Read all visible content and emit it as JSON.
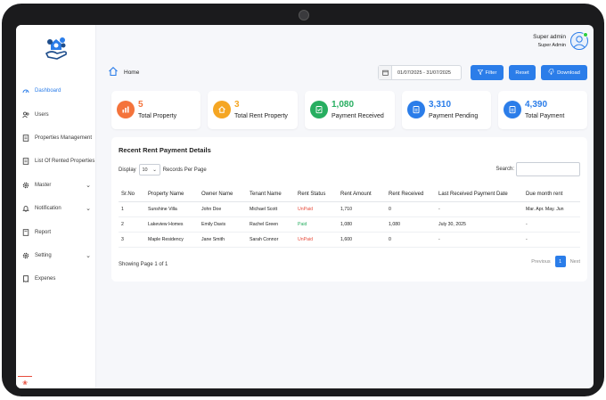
{
  "user": {
    "name": "Super admin",
    "role": "Super Admin"
  },
  "breadcrumb": {
    "label": "Home"
  },
  "filters": {
    "date_range": "01/07/2025 - 31/07/2025",
    "filter_label": "Filter",
    "reset_label": "Reset",
    "download_label": "Download"
  },
  "sidebar": {
    "items": [
      {
        "label": "Dashboard",
        "icon": "dashboard-icon",
        "active": true
      },
      {
        "label": "Users",
        "icon": "users-icon"
      },
      {
        "label": "Properties Management",
        "icon": "document-icon"
      },
      {
        "label": "List Of Rented Properties",
        "icon": "document-icon"
      },
      {
        "label": "Master",
        "icon": "gear-icon",
        "expandable": true
      },
      {
        "label": "Notification",
        "icon": "bell-icon",
        "expandable": true
      },
      {
        "label": "Report",
        "icon": "report-icon"
      },
      {
        "label": "Setting",
        "icon": "gear-icon",
        "expandable": true
      },
      {
        "label": "Expenes",
        "icon": "receipt-icon"
      }
    ]
  },
  "cards": [
    {
      "value": "5",
      "label": "Total Property",
      "color": "#f4733b"
    },
    {
      "value": "3",
      "label": "Total Rent Property",
      "color": "#f5a623"
    },
    {
      "value": "1,080",
      "label": "Payment Received",
      "color": "#27ae60"
    },
    {
      "value": "3,310",
      "label": "Payment Pending",
      "color": "#2b7de9"
    },
    {
      "value": "4,390",
      "label": "Total Payment",
      "color": "#2b7de9"
    }
  ],
  "table_section": {
    "title": "Recent Rent Payment Details",
    "display_label": "Display",
    "per_page_value": "10",
    "records_label": "Records Per Page",
    "search_label": "Search:",
    "showing_text": "Showing Page 1 of 1",
    "pager": {
      "previous": "Previous",
      "page": "1",
      "next": "Next"
    },
    "columns": [
      "Sr.No",
      "Property Name",
      "Owner Name",
      "Tenant Name",
      "Rent Status",
      "Rent Amount",
      "Rent Received",
      "Last Received Payment Date",
      "Due month rent"
    ],
    "rows": [
      [
        "1",
        "Sunshine Villa",
        "John Doe",
        "Michael Scott",
        "UnPaid",
        "1,710",
        "0",
        "-",
        "Mar. Apr. May. Jun"
      ],
      [
        "2",
        "Lakeview Homes",
        "Emily Davis",
        "Rachel Green",
        "Paid",
        "1,080",
        "1,080",
        "July 30, 2025",
        "-"
      ],
      [
        "3",
        "Maple Residency",
        "Jane Smith",
        "Sarah Connor",
        "UnPaid",
        "1,600",
        "0",
        "-",
        "-"
      ]
    ]
  },
  "colors": {
    "accent": "#2b7de9",
    "paid": "#27ae60",
    "unpaid": "#e74c3c"
  }
}
